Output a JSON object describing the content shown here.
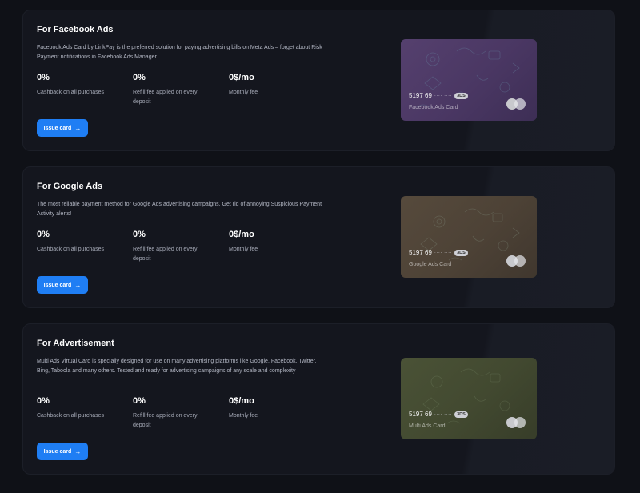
{
  "sections": [
    {
      "title": "For Facebook Ads",
      "description": "Facebook Ads Card by LinkPay is the preferred solution for paying advertising bills on Meta Ads – forget about Risk Payment notifications in Facebook Ads Manager",
      "stats": [
        {
          "value": "0%",
          "label": "Cashback on all purchases"
        },
        {
          "value": "0%",
          "label": "Refill fee applied on every deposit"
        },
        {
          "value": "0$/mo",
          "label": "Monthly fee"
        }
      ],
      "button_label": "Issue card",
      "card": {
        "number": "5197 69",
        "masked": "···· ····",
        "badge": "3DS",
        "name": "Facebook Ads Card",
        "color": "#4a3763"
      }
    },
    {
      "title": "For Google Ads",
      "description": "The most reliable payment method for Google Ads advertising campaigns. Get rid of annoying Suspicious Payment Activity alerts!",
      "stats": [
        {
          "value": "0%",
          "label": "Cashback on all purchases"
        },
        {
          "value": "0%",
          "label": "Refill fee applied on every deposit"
        },
        {
          "value": "0$/mo",
          "label": "Monthly fee"
        }
      ],
      "button_label": "Issue card",
      "card": {
        "number": "5197 69",
        "masked": "···· ····",
        "badge": "3DS",
        "name": "Google Ads Card",
        "color": "#4d4236"
      }
    },
    {
      "title": "For Advertisement",
      "description": "Multi Ads Virtual Card is specially designed for use on many advertising platforms like Google, Facebook, Twitter, Bing, Taboola and many others. Tested and ready for advertising campaigns of any scale and complexity",
      "stats": [
        {
          "value": "0%",
          "label": "Cashback on all purchases"
        },
        {
          "value": "0%",
          "label": "Refill fee applied on every deposit"
        },
        {
          "value": "0$/mo",
          "label": "Monthly fee"
        }
      ],
      "button_label": "Issue card",
      "card": {
        "number": "5197 69",
        "masked": "···· ····",
        "badge": "3DS",
        "name": "Multi Ads Card",
        "color": "#424930"
      }
    }
  ],
  "icons": {
    "button_arrow": "arrow-right-icon",
    "card_logo": "mastercard-circles-icon"
  }
}
